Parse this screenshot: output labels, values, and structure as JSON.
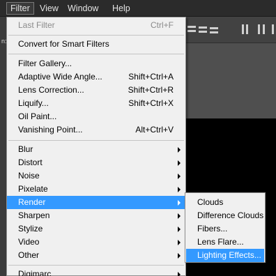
{
  "menubar": {
    "items": [
      "Filter",
      "View",
      "Window",
      "Help"
    ]
  },
  "options_bar": {
    "left_edge_text": "n:"
  },
  "filter_menu": {
    "items": [
      {
        "label": "Last Filter",
        "shortcut": "Ctrl+F",
        "disabled": true
      },
      {
        "label": "Convert for Smart Filters",
        "shortcut": ""
      },
      {
        "label": "Filter Gallery...",
        "shortcut": ""
      },
      {
        "label": "Adaptive Wide Angle...",
        "shortcut": "Shift+Ctrl+A"
      },
      {
        "label": "Lens Correction...",
        "shortcut": "Shift+Ctrl+R"
      },
      {
        "label": "Liquify...",
        "shortcut": "Shift+Ctrl+X"
      },
      {
        "label": "Oil Paint...",
        "shortcut": ""
      },
      {
        "label": "Vanishing Point...",
        "shortcut": "Alt+Ctrl+V"
      },
      {
        "label": "Blur",
        "submenu": true
      },
      {
        "label": "Distort",
        "submenu": true
      },
      {
        "label": "Noise",
        "submenu": true
      },
      {
        "label": "Pixelate",
        "submenu": true
      },
      {
        "label": "Render",
        "submenu": true,
        "highlighted": true
      },
      {
        "label": "Sharpen",
        "submenu": true
      },
      {
        "label": "Stylize",
        "submenu": true
      },
      {
        "label": "Video",
        "submenu": true
      },
      {
        "label": "Other",
        "submenu": true
      },
      {
        "label": "Digimarc",
        "submenu": true
      }
    ]
  },
  "render_submenu": {
    "items": [
      {
        "label": "Clouds"
      },
      {
        "label": "Difference Clouds"
      },
      {
        "label": "Fibers..."
      },
      {
        "label": "Lens Flare..."
      },
      {
        "label": "Lighting Effects...",
        "highlighted": true
      }
    ]
  },
  "colors": {
    "highlight": "#3399ff",
    "menu_bg": "#f0f0f0",
    "menubar_bg": "#2b2b2b",
    "disabled_text": "#8a8a8a"
  }
}
